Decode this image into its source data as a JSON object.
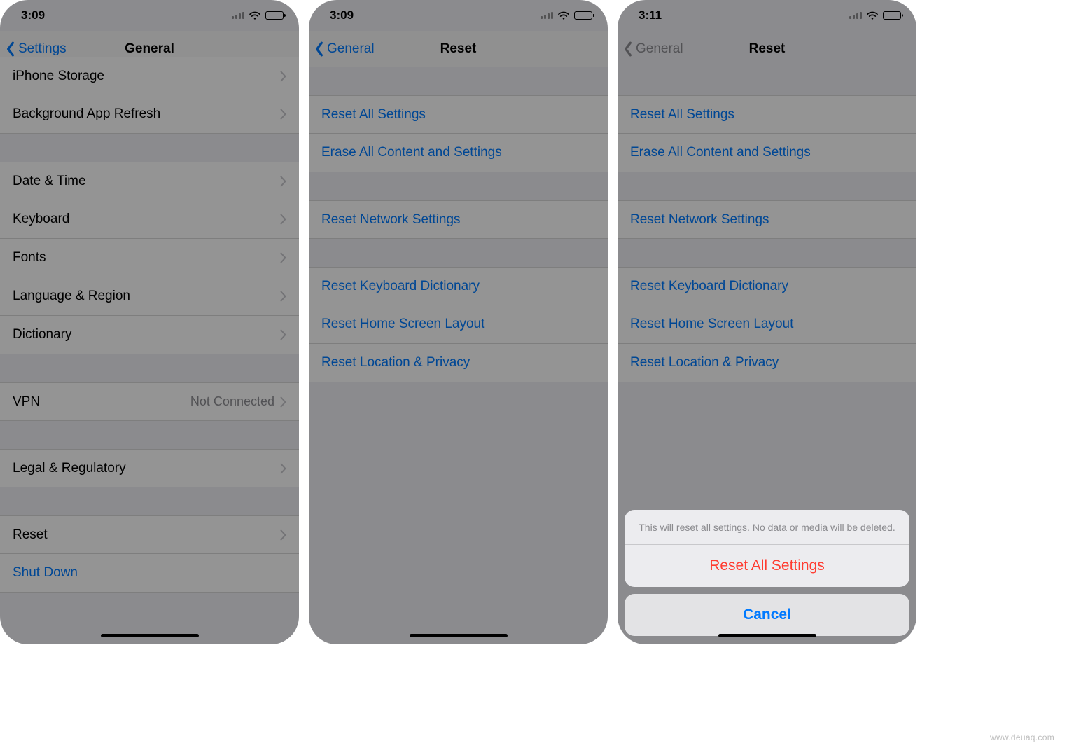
{
  "watermark": "www.deuaq.com",
  "panels": [
    {
      "time": "3:09",
      "back": "Settings",
      "title": "General",
      "back_disabled": false,
      "navbar_transparent": false,
      "groups": [
        {
          "gap": "none",
          "rows": [
            {
              "label": "iPhone Storage",
              "chevron": true,
              "highlight": false
            },
            {
              "label": "Background App Refresh",
              "chevron": true,
              "highlight": false
            }
          ]
        },
        {
          "gap": "normal",
          "rows": [
            {
              "label": "Date & Time",
              "chevron": true,
              "highlight": false
            },
            {
              "label": "Keyboard",
              "chevron": true,
              "highlight": false
            },
            {
              "label": "Fonts",
              "chevron": true,
              "highlight": false
            },
            {
              "label": "Language & Region",
              "chevron": true,
              "highlight": false
            },
            {
              "label": "Dictionary",
              "chevron": true,
              "highlight": false
            }
          ]
        },
        {
          "gap": "normal",
          "rows": [
            {
              "label": "VPN",
              "value": "Not Connected",
              "chevron": true,
              "highlight": false
            }
          ]
        },
        {
          "gap": "normal",
          "rows": [
            {
              "label": "Legal & Regulatory",
              "chevron": true,
              "highlight": false
            }
          ]
        },
        {
          "gap": "normal",
          "rows": [
            {
              "label": "Reset",
              "chevron": true,
              "highlight": true
            },
            {
              "label": "Shut Down",
              "link": true,
              "highlight": false
            }
          ]
        }
      ]
    },
    {
      "time": "3:09",
      "back": "General",
      "title": "Reset",
      "back_disabled": false,
      "navbar_transparent": false,
      "groups": [
        {
          "gap": "normal",
          "rows": [
            {
              "label": "Reset All Settings",
              "link": true,
              "highlight": true
            },
            {
              "label": "Erase All Content and Settings",
              "link": true,
              "highlight": false
            }
          ]
        },
        {
          "gap": "normal",
          "rows": [
            {
              "label": "Reset Network Settings",
              "link": true,
              "highlight": false
            }
          ]
        },
        {
          "gap": "normal",
          "rows": [
            {
              "label": "Reset Keyboard Dictionary",
              "link": true,
              "highlight": false
            },
            {
              "label": "Reset Home Screen Layout",
              "link": true,
              "highlight": false
            },
            {
              "label": "Reset Location & Privacy",
              "link": true,
              "highlight": false
            }
          ]
        }
      ]
    },
    {
      "time": "3:11",
      "back": "General",
      "title": "Reset",
      "back_disabled": true,
      "navbar_transparent": true,
      "groups": [
        {
          "gap": "normal",
          "rows": [
            {
              "label": "Reset All Settings",
              "link": true,
              "highlight": false
            },
            {
              "label": "Erase All Content and Settings",
              "link": true,
              "highlight": false
            }
          ]
        },
        {
          "gap": "normal",
          "rows": [
            {
              "label": "Reset Network Settings",
              "link": true,
              "highlight": false
            }
          ]
        },
        {
          "gap": "normal",
          "rows": [
            {
              "label": "Reset Keyboard Dictionary",
              "link": true,
              "highlight": false
            },
            {
              "label": "Reset Home Screen Layout",
              "link": true,
              "highlight": false
            },
            {
              "label": "Reset Location & Privacy",
              "link": true,
              "highlight": false
            }
          ]
        }
      ],
      "sheet": {
        "message": "This will reset all settings. No data or media will be deleted.",
        "action": "Reset All Settings",
        "cancel": "Cancel"
      }
    }
  ]
}
